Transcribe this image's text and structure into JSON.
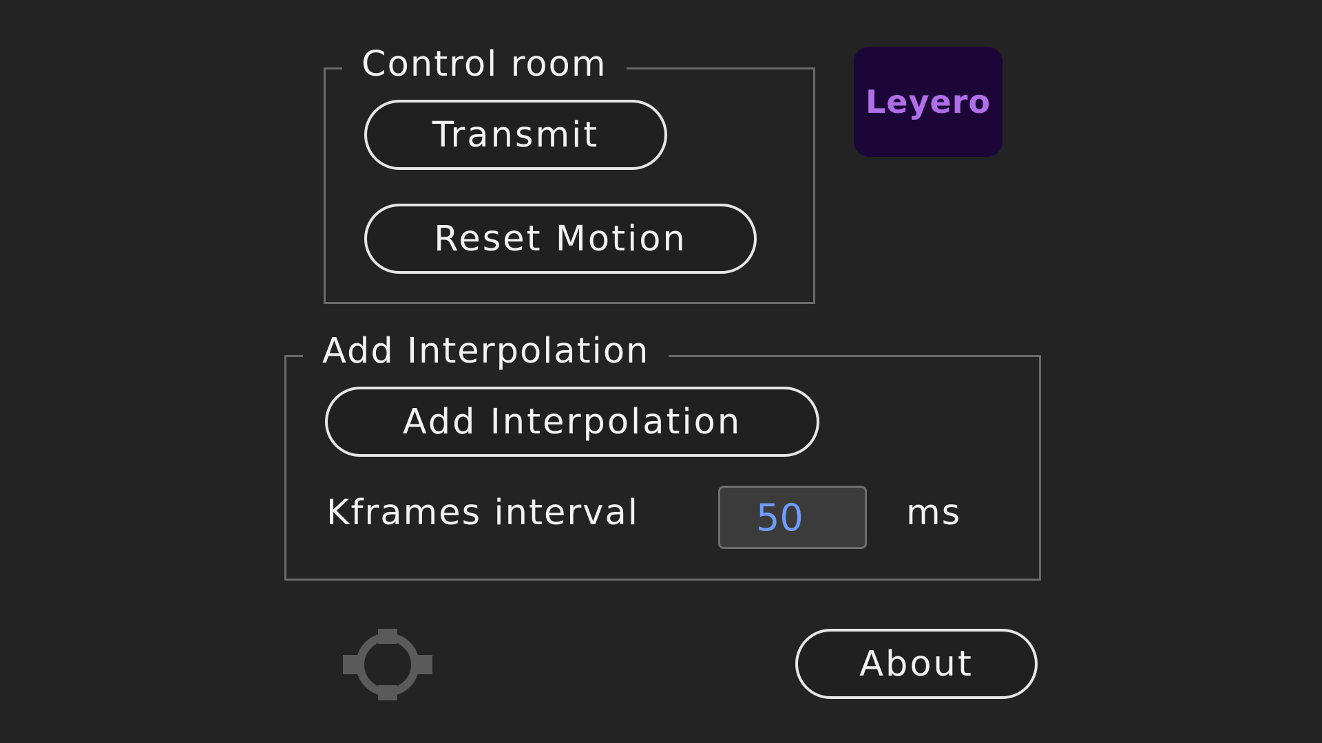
{
  "control_room": {
    "title": "Control room",
    "transmit_label": "Transmit",
    "reset_motion_label": "Reset Motion"
  },
  "logo": {
    "text": "Leyero",
    "color": "#b06ee8",
    "background": "#1c0638"
  },
  "interpolation": {
    "title": "Add Interpolation",
    "add_button_label": "Add Interpolation",
    "kframes_label": "Kframes interval",
    "kframes_value": "50",
    "unit": "ms"
  },
  "footer": {
    "target_icon": "crosshair-target-icon",
    "about_label": "About"
  },
  "colors": {
    "background": "#232323",
    "border": "#6a6a6a",
    "input_value": "#6f9cff"
  }
}
